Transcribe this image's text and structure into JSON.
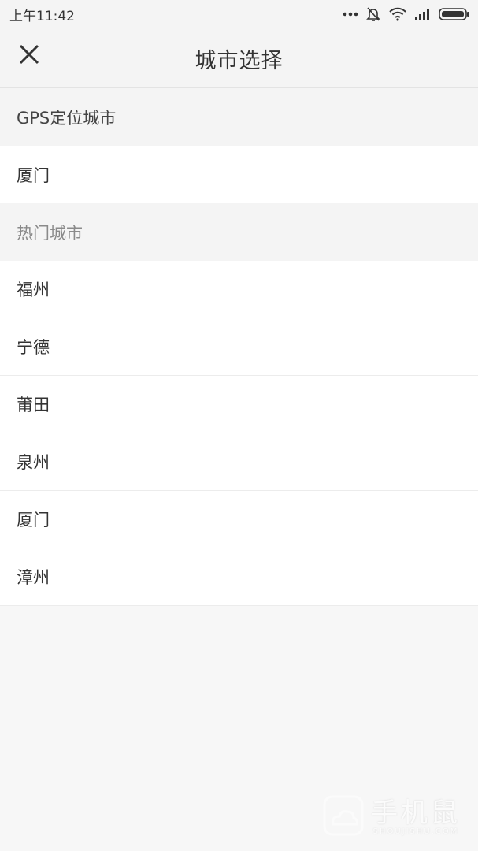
{
  "status_bar": {
    "time": "上午11:42",
    "icons": [
      "more-dots-icon",
      "bell-off-icon",
      "wifi-icon",
      "signal-icon",
      "battery-icon"
    ]
  },
  "header": {
    "title": "城市选择",
    "close_icon": "close-icon"
  },
  "gps_section": {
    "label": "GPS定位城市",
    "city": "厦门"
  },
  "hot_section": {
    "label": "热门城市",
    "cities": [
      "福州",
      "宁德",
      "莆田",
      "泉州",
      "厦门",
      "漳州"
    ]
  },
  "watermark": {
    "brand_cn": "手机鼠",
    "brand_en": "SHOUJISHU.COM"
  },
  "colors": {
    "background": "#f7f7f7",
    "header_bg": "#f4f4f4",
    "row_bg": "#ffffff",
    "text": "#333333",
    "muted_text": "#8a8a8a"
  }
}
